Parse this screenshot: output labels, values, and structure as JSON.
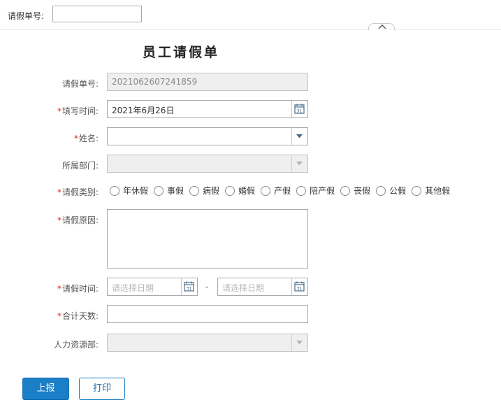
{
  "search": {
    "label": "请假单号:",
    "value": ""
  },
  "form": {
    "title": "员工请假单",
    "required_mark": "*",
    "fields": {
      "leave_no": {
        "label": "请假单号:",
        "value": "2021062607241859"
      },
      "fill_time": {
        "label": "填写时间:",
        "value": "2021年6月26日"
      },
      "name": {
        "label": "姓名:",
        "value": ""
      },
      "department": {
        "label": "所属部门:",
        "value": ""
      },
      "leave_type": {
        "label": "请假类别:",
        "options": [
          "年休假",
          "事假",
          "病假",
          "婚假",
          "产假",
          "陪产假",
          "丧假",
          "公假",
          "其他假"
        ]
      },
      "reason": {
        "label": "请假原因:",
        "value": ""
      },
      "leave_time": {
        "label": "请假时间:",
        "start_placeholder": "请选择日期",
        "end_placeholder": "请选择日期",
        "separator": "-"
      },
      "total_days": {
        "label": "合计天数:",
        "value": ""
      },
      "hr": {
        "label": "人力资源部:",
        "value": ""
      }
    }
  },
  "actions": {
    "submit_label": "上报",
    "print_label": "打印"
  },
  "icons": {
    "calendar": "calendar-icon",
    "dropdown": "chevron-down-icon",
    "collapse": "chevron-up-icon"
  },
  "colors": {
    "primary": "#1a7fc7",
    "required": "#e02020",
    "calendar_icon": "#4a6d8c"
  }
}
